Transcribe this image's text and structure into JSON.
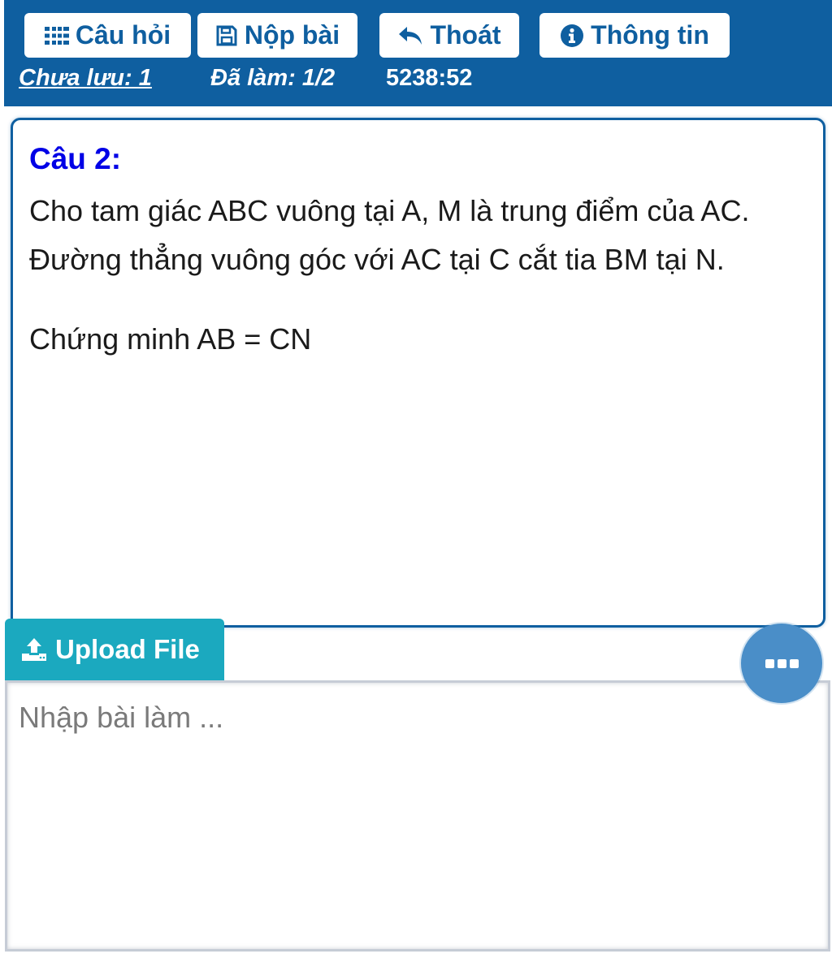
{
  "toolbar": {
    "questions_label": "Câu hỏi",
    "submit_label": "Nộp bài",
    "exit_label": "Thoát",
    "info_label": "Thông tin"
  },
  "status": {
    "unsaved": "Chưa lưu: 1",
    "done": "Đã làm: 1/2",
    "timer": "5238:52"
  },
  "question": {
    "title": "Câu 2:",
    "paragraph_1": "Cho tam giác ABC vuông tại A, M là trung điểm của AC. Đường thẳng vuông góc với AC tại C cắt tia BM tại N.",
    "paragraph_2": "Chứng minh AB = CN"
  },
  "answer": {
    "upload_label": "Upload File",
    "placeholder": "Nhập bài làm ...",
    "value": ""
  },
  "icons": {
    "questions": "grid-icon",
    "submit": "save-icon",
    "exit": "reply-icon",
    "info": "info-icon",
    "upload": "upload-icon",
    "more": "ellipsis-icon"
  },
  "colors": {
    "header_bg": "#0f5fa0",
    "title_blue": "#0000e6",
    "upload_bg": "#1ba9bf",
    "fab_bg": "#4a8ec8"
  }
}
